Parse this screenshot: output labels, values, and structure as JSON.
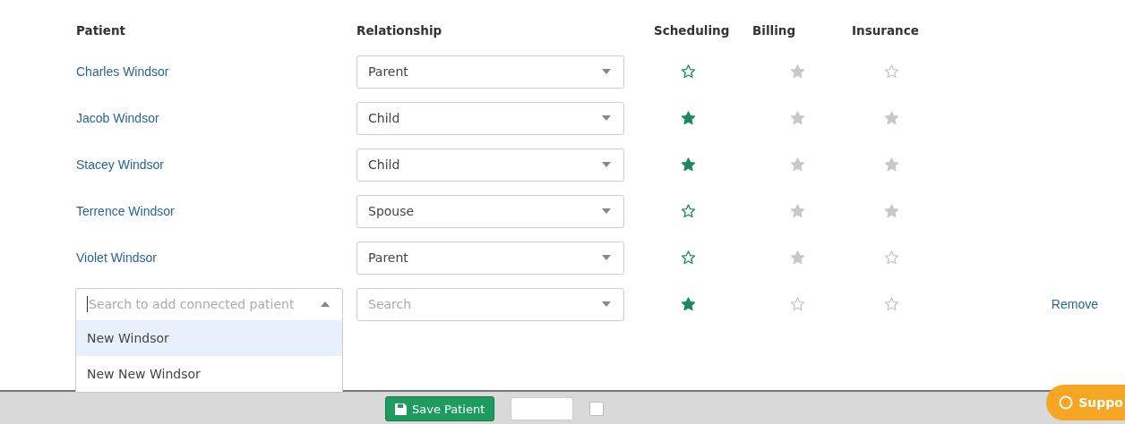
{
  "columns": [
    {
      "label": "Patient"
    },
    {
      "label": "Relationship"
    },
    {
      "label": "Scheduling",
      "disabled": false
    },
    {
      "label": "Billing",
      "disabled": true
    },
    {
      "label": "Insurance",
      "disabled": true
    }
  ],
  "rows": [
    {
      "patient": "Charles Windsor",
      "relationship": "Parent",
      "stars": [
        false,
        true,
        false
      ]
    },
    {
      "patient": "Jacob Windsor",
      "relationship": "Child",
      "stars": [
        true,
        true,
        true
      ]
    },
    {
      "patient": "Stacey Windsor",
      "relationship": "Child",
      "stars": [
        true,
        true,
        true
      ]
    },
    {
      "patient": "Terrence Windsor",
      "relationship": "Spouse",
      "stars": [
        false,
        true,
        true
      ]
    },
    {
      "patient": "Violet Windsor",
      "relationship": "Parent",
      "stars": [
        false,
        true,
        false
      ]
    }
  ],
  "new_row": {
    "patient_search": {
      "placeholder": "Search to add connected patient",
      "expanded": true,
      "options": [
        {
          "label": "New Windsor",
          "selected": true
        },
        {
          "label": "New New Windsor",
          "selected": false
        }
      ]
    },
    "relationship": {
      "placeholder": "Search"
    },
    "stars": [
      true,
      false,
      false
    ],
    "remove": "Remove"
  },
  "footer": {
    "save_button": "Save Patient",
    "support": "Suppo",
    "checkbox": {
      "checked": false
    }
  }
}
